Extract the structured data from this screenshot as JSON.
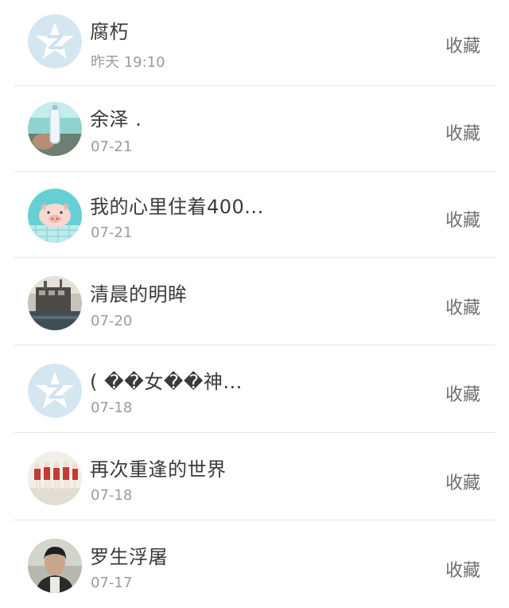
{
  "favorites": [
    {
      "avatar_icon": "qzone-default-avatar-icon",
      "name": "腐朽",
      "time": "昨天 19:10",
      "action": "收藏"
    },
    {
      "avatar_icon": "bottle-photo-avatar-icon",
      "name": "余泽 .",
      "time": "07-21",
      "action": "收藏"
    },
    {
      "avatar_icon": "pig-cartoon-avatar-icon",
      "name": "我的心里住着400...",
      "time": "07-21",
      "action": "收藏"
    },
    {
      "avatar_icon": "ship-photo-avatar-icon",
      "name": "清晨的明眸",
      "time": "07-20",
      "action": "收藏"
    },
    {
      "avatar_icon": "qzone-default-avatar-icon",
      "name": "( ��女��神...",
      "time": "07-18",
      "action": "收藏"
    },
    {
      "avatar_icon": "dancers-photo-avatar-icon",
      "name": "再次重逢的世界",
      "time": "07-18",
      "action": "收藏"
    },
    {
      "avatar_icon": "person-photo-avatar-icon",
      "name": "罗生浮屠",
      "time": "07-17",
      "action": "收藏"
    }
  ],
  "colors": {
    "name_text": "#3a3a3a",
    "time_text": "#9b9b9b",
    "action_text": "#6f6f6f",
    "divider": "#e3e3e3",
    "default_avatar": "#d5e6f1"
  }
}
